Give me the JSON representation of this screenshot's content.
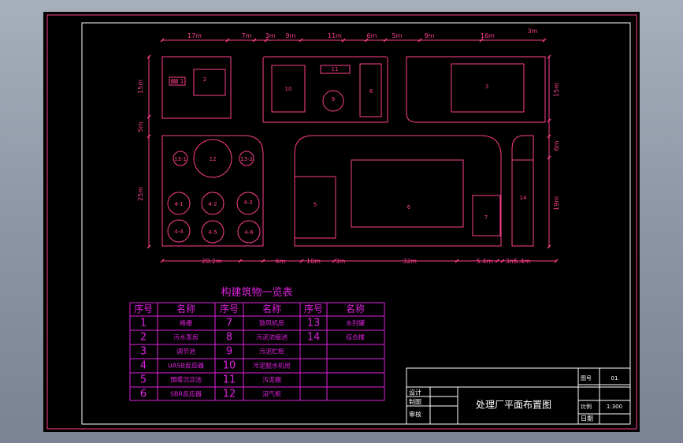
{
  "colors": {
    "background": "#000000",
    "frame": "#ffffff",
    "plan": "#ff3f8c",
    "table": "#e020e0",
    "title_block": "#ffffff"
  },
  "plan": {
    "top_dims": [
      "17m",
      "7m",
      "3m",
      "9m",
      "11m",
      "6m",
      "5m",
      "9m",
      "16m",
      "3m"
    ],
    "bottom_dims": [
      "20.2m",
      "6m",
      "10m",
      "3m",
      "32m",
      "5.4m",
      "3m",
      "5.4m"
    ],
    "left_dims": [
      "15m",
      "5m",
      "25m"
    ],
    "right_dims": [
      "15m",
      "6m",
      "19m"
    ],
    "buildings": {
      "b1": "1",
      "b2": "2",
      "b3": "3",
      "b5": "5",
      "b6": "6",
      "b7": "7",
      "b8": "8",
      "b9": "9",
      "b10": "10",
      "b11": "11",
      "b12": "12",
      "b13_1": "13-1",
      "b13_2": "13-2",
      "b14": "14",
      "t4_1": "4-1",
      "t4_2": "4-2",
      "t4_3": "4-3",
      "t4_4": "4-4",
      "t4_5": "4-5",
      "t4_6": "4-6"
    }
  },
  "structures_table": {
    "title": "构建筑物一览表",
    "headers": [
      "序号",
      "名称",
      "序号",
      "名称",
      "序号",
      "名称"
    ],
    "rows": [
      [
        "1",
        "格栅",
        "7",
        "鼓风机房",
        "13",
        "水封罐"
      ],
      [
        "2",
        "污水泵房",
        "8",
        "污泥浓缩池",
        "14",
        "综合楼"
      ],
      [
        "3",
        "调节池",
        "9",
        "污泥贮柜",
        "",
        ""
      ],
      [
        "4",
        "UASB反应器",
        "10",
        "污泥脱水机房",
        "",
        ""
      ],
      [
        "5",
        "預曝沉淀池",
        "11",
        "污泥棚",
        "",
        ""
      ],
      [
        "6",
        "SBR反应器",
        "12",
        "沼气柜",
        "",
        ""
      ]
    ]
  },
  "title_block": {
    "design": "设计",
    "draft": "制图",
    "review": "审核",
    "drawing_title": "处理厂平面布置图",
    "drawing_no_label": "图号",
    "drawing_no": "01",
    "scale_label": "比例",
    "scale": "1:300",
    "date_label": "日期"
  }
}
